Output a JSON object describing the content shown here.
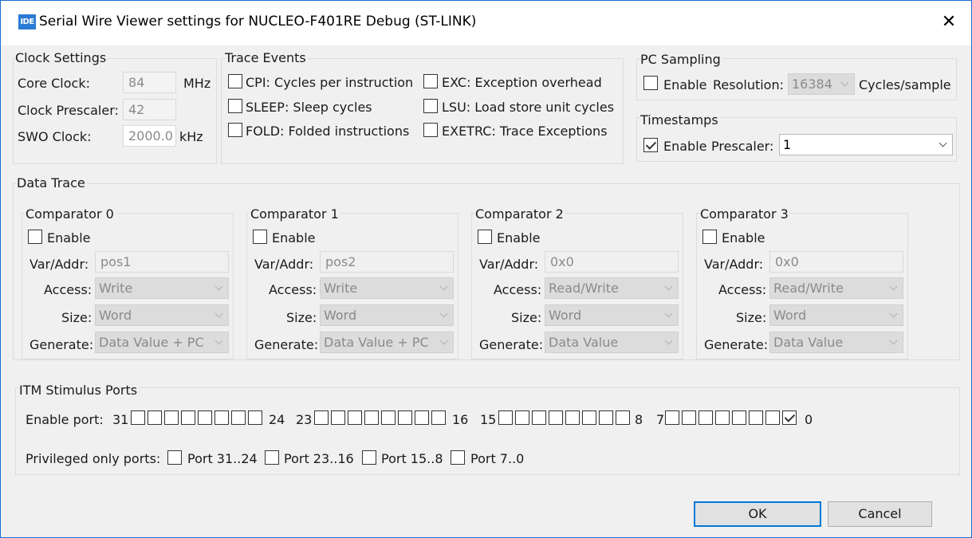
{
  "window": {
    "app_icon": "IDE",
    "title": "Serial Wire Viewer settings for NUCLEO-F401RE Debug (ST-LINK)",
    "close_glyph": "✕"
  },
  "clock": {
    "group_label": "Clock Settings",
    "core_label": "Core Clock:",
    "core_value": "84",
    "core_unit": "MHz",
    "prescaler_label": "Clock Prescaler:",
    "prescaler_value": "42",
    "swo_label": "SWO Clock:",
    "swo_value": "2000.0",
    "swo_unit": "kHz"
  },
  "trace_events": {
    "group_label": "Trace Events",
    "items": [
      {
        "label": "CPI: Cycles per instruction",
        "checked": false
      },
      {
        "label": "SLEEP: Sleep cycles",
        "checked": false
      },
      {
        "label": "FOLD: Folded instructions",
        "checked": false
      },
      {
        "label": "EXC: Exception overhead",
        "checked": false
      },
      {
        "label": "LSU: Load store unit cycles",
        "checked": false
      },
      {
        "label": "EXETRC: Trace Exceptions",
        "checked": false
      }
    ]
  },
  "pc_sampling": {
    "group_label": "PC Sampling",
    "enable_label": "Enable",
    "enabled": false,
    "resolution_label": "Resolution:",
    "resolution_value": "16384",
    "resolution_unit": "Cycles/sample"
  },
  "timestamps": {
    "group_label": "Timestamps",
    "enable_label": "Enable",
    "enabled": true,
    "prescaler_label": "Prescaler:",
    "prescaler_value": "1"
  },
  "data_trace": {
    "group_label": "Data Trace",
    "enable_label": "Enable",
    "var_label": "Var/Addr:",
    "access_label": "Access:",
    "size_label": "Size:",
    "generate_label": "Generate:",
    "comparators": [
      {
        "title": "Comparator 0",
        "enabled": false,
        "var": "pos1",
        "access": "Write",
        "size": "Word",
        "generate": "Data Value + PC"
      },
      {
        "title": "Comparator 1",
        "enabled": false,
        "var": "pos2",
        "access": "Write",
        "size": "Word",
        "generate": "Data Value + PC"
      },
      {
        "title": "Comparator 2",
        "enabled": false,
        "var": "0x0",
        "access": "Read/Write",
        "size": "Word",
        "generate": "Data Value"
      },
      {
        "title": "Comparator 3",
        "enabled": false,
        "var": "0x0",
        "access": "Read/Write",
        "size": "Word",
        "generate": "Data Value"
      }
    ]
  },
  "itm": {
    "group_label": "ITM Stimulus Ports",
    "enable_label": "Enable port:",
    "port_groups": [
      {
        "start": "31",
        "end": "24"
      },
      {
        "start": "23",
        "end": "16"
      },
      {
        "start": "15",
        "end": "8"
      },
      {
        "start": "7",
        "end": "0"
      }
    ],
    "enabled_ports": [
      0
    ],
    "privileged_label": "Privileged only ports:",
    "privileged_ports": [
      {
        "label": "Port 31..24",
        "checked": false
      },
      {
        "label": "Port 23..16",
        "checked": false
      },
      {
        "label": "Port 15..8",
        "checked": false
      },
      {
        "label": "Port 7..0",
        "checked": false
      }
    ]
  },
  "buttons": {
    "ok": "OK",
    "cancel": "Cancel"
  }
}
